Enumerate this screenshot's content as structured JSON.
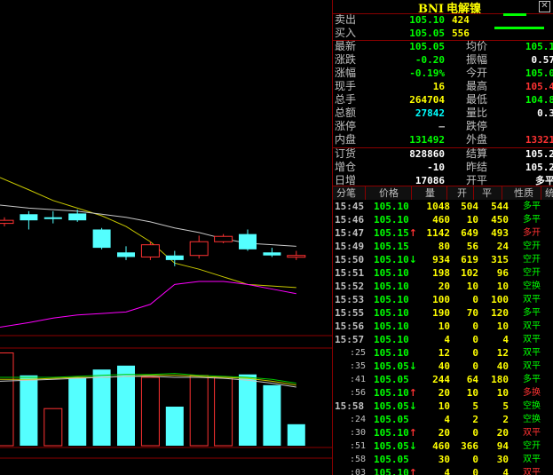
{
  "colors": {
    "up": "#ff3232",
    "down": "#00ff00",
    "volume": "#ffff00",
    "label": "#c0c0c0",
    "grid": "#8b0000",
    "ma_yellow": "#c8c800",
    "ma_white": "#c8c8c8",
    "ma_magenta": "#ff00ff",
    "candle_down": "#54ffff",
    "candle_up": "#ff3232"
  },
  "title": {
    "code": "BNI",
    "name": "电解镍"
  },
  "orderbook": {
    "sell": {
      "label": "卖出",
      "price": "105.10",
      "vol": "424",
      "bar_fraction": 0.43
    },
    "buy": {
      "label": "买入",
      "price": "105.05",
      "vol": "556",
      "bar_fraction": 0.56
    }
  },
  "stats": [
    {
      "l1": "最新",
      "v1": "105.05",
      "c1": "green",
      "l2": "均价",
      "v2": "105.1",
      "c2": "green"
    },
    {
      "l1": "涨跌",
      "v1": "-0.20",
      "c1": "green",
      "l2": "振幅",
      "v2": "0.57",
      "c2": "white"
    },
    {
      "l1": "涨幅",
      "v1": "-0.19%",
      "c1": "green",
      "l2": "今开",
      "v2": "105.0",
      "c2": "green"
    },
    {
      "l1": "现手",
      "v1": "16",
      "c1": "yellow",
      "l2": "最高",
      "v2": "105.4",
      "c2": "red"
    },
    {
      "l1": "总手",
      "v1": "264704",
      "c1": "yellow",
      "l2": "最低",
      "v2": "104.8",
      "c2": "green"
    },
    {
      "l1": "总额",
      "v1": "27842",
      "c1": "cyan",
      "l2": "量比",
      "v2": "0.3",
      "c2": "white"
    },
    {
      "l1": "涨停",
      "v1": "–",
      "c1": "label",
      "l2": "跌停",
      "v2": "",
      "c2": "label"
    },
    {
      "l1": "内盘",
      "v1": "131492",
      "c1": "green",
      "l2": "外盘",
      "v2": "13321",
      "c2": "red"
    }
  ],
  "stats2": [
    {
      "l1": "订货",
      "v1": "828860",
      "c1": "white",
      "l2": "结算",
      "v2": "105.2",
      "c2": "white"
    },
    {
      "l1": "增仓",
      "v1": "-10",
      "c1": "white",
      "l2": "昨结",
      "v2": "105.2",
      "c2": "white"
    },
    {
      "l1": "日增",
      "v1": "17086",
      "c1": "white",
      "l2": "开平",
      "v2": "多平",
      "c2": "white"
    }
  ],
  "ticks_header": {
    "time": "分笔",
    "price": "价格",
    "vol": "量",
    "open": "开",
    "close": "平",
    "nature": "性质",
    "extra": "统"
  },
  "ticks": [
    {
      "time": "15:45",
      "sub": false,
      "price": "105.10",
      "pc": "green",
      "arrow": "",
      "vol": "1048",
      "open": "504",
      "close": "544",
      "nature": "多平",
      "nc": "green"
    },
    {
      "time": "15:46",
      "sub": false,
      "price": "105.10",
      "pc": "green",
      "arrow": "",
      "vol": "460",
      "open": "10",
      "close": "450",
      "nature": "多平",
      "nc": "green"
    },
    {
      "time": "15:47",
      "sub": false,
      "price": "105.15",
      "pc": "green",
      "arrow": "↑",
      "ac": "red",
      "vol": "1142",
      "open": "649",
      "close": "493",
      "nature": "多开",
      "nc": "red"
    },
    {
      "time": "15:49",
      "sub": false,
      "price": "105.15",
      "pc": "green",
      "arrow": "",
      "vol": "80",
      "open": "56",
      "close": "24",
      "nature": "空开",
      "nc": "green"
    },
    {
      "time": "15:50",
      "sub": false,
      "price": "105.10",
      "pc": "green",
      "arrow": "↓",
      "ac": "green",
      "vol": "934",
      "open": "619",
      "close": "315",
      "nature": "空开",
      "nc": "green"
    },
    {
      "time": "15:51",
      "sub": false,
      "price": "105.10",
      "pc": "green",
      "arrow": "",
      "vol": "198",
      "open": "102",
      "close": "96",
      "nature": "空开",
      "nc": "green"
    },
    {
      "time": "15:52",
      "sub": false,
      "price": "105.10",
      "pc": "green",
      "arrow": "",
      "vol": "20",
      "open": "10",
      "close": "10",
      "nature": "空换",
      "nc": "green"
    },
    {
      "time": "15:53",
      "sub": false,
      "price": "105.10",
      "pc": "green",
      "arrow": "",
      "vol": "100",
      "open": "0",
      "close": "100",
      "nature": "双平",
      "nc": "green"
    },
    {
      "time": "15:55",
      "sub": false,
      "price": "105.10",
      "pc": "green",
      "arrow": "",
      "vol": "190",
      "open": "70",
      "close": "120",
      "nature": "多平",
      "nc": "green"
    },
    {
      "time": "15:56",
      "sub": false,
      "price": "105.10",
      "pc": "green",
      "arrow": "",
      "vol": "10",
      "open": "0",
      "close": "10",
      "nature": "双平",
      "nc": "green"
    },
    {
      "time": "15:57",
      "sub": false,
      "price": "105.10",
      "pc": "green",
      "arrow": "",
      "vol": "4",
      "open": "0",
      "close": "4",
      "nature": "双平",
      "nc": "green"
    },
    {
      "time": ":25",
      "sub": true,
      "price": "105.10",
      "pc": "green",
      "arrow": "",
      "vol": "12",
      "open": "0",
      "close": "12",
      "nature": "双平",
      "nc": "green"
    },
    {
      "time": ":35",
      "sub": true,
      "price": "105.05",
      "pc": "green",
      "arrow": "↓",
      "ac": "green",
      "vol": "40",
      "open": "0",
      "close": "40",
      "nature": "双平",
      "nc": "green"
    },
    {
      "time": ":41",
      "sub": true,
      "price": "105.05",
      "pc": "green",
      "arrow": "",
      "vol": "244",
      "open": "64",
      "close": "180",
      "nature": "多平",
      "nc": "green"
    },
    {
      "time": ":56",
      "sub": true,
      "price": "105.10",
      "pc": "green",
      "arrow": "↑",
      "ac": "red",
      "vol": "20",
      "open": "10",
      "close": "10",
      "nature": "多换",
      "nc": "red"
    },
    {
      "time": "15:58",
      "sub": false,
      "price": "105.05",
      "pc": "green",
      "arrow": "↓",
      "ac": "green",
      "vol": "10",
      "open": "5",
      "close": "5",
      "nature": "空换",
      "nc": "green"
    },
    {
      "time": ":24",
      "sub": true,
      "price": "105.05",
      "pc": "green",
      "arrow": "",
      "vol": "4",
      "open": "2",
      "close": "2",
      "nature": "空换",
      "nc": "green"
    },
    {
      "time": ":30",
      "sub": true,
      "price": "105.10",
      "pc": "green",
      "arrow": "↑",
      "ac": "red",
      "vol": "20",
      "open": "0",
      "close": "20",
      "nature": "双平",
      "nc": "red"
    },
    {
      "time": ":51",
      "sub": true,
      "price": "105.05",
      "pc": "green",
      "arrow": "↓",
      "ac": "green",
      "vol": "460",
      "open": "366",
      "close": "94",
      "nature": "空开",
      "nc": "green"
    },
    {
      "time": ":58",
      "sub": true,
      "price": "105.05",
      "pc": "green",
      "arrow": "",
      "vol": "30",
      "open": "0",
      "close": "30",
      "nature": "双平",
      "nc": "green"
    },
    {
      "time": ":03",
      "sub": true,
      "price": "105.10",
      "pc": "green",
      "arrow": "↑",
      "ac": "red",
      "vol": "4",
      "open": "0",
      "close": "4",
      "nature": "双平",
      "nc": "red"
    }
  ],
  "chart_data": {
    "type": "candlestick",
    "candles": [
      {
        "open": 0.7,
        "close": 0.72,
        "high": 0.74,
        "low": 0.68,
        "dir": "up"
      },
      {
        "open": 0.76,
        "close": 0.72,
        "high": 0.78,
        "low": 0.66,
        "dir": "down"
      },
      {
        "open": 0.74,
        "close": 0.735,
        "high": 0.78,
        "low": 0.7,
        "dir": "down"
      },
      {
        "open": 0.765,
        "close": 0.72,
        "high": 0.79,
        "low": 0.71,
        "dir": "down"
      },
      {
        "open": 0.66,
        "close": 0.54,
        "high": 0.67,
        "low": 0.53,
        "dir": "down"
      },
      {
        "open": 0.51,
        "close": 0.48,
        "high": 0.55,
        "low": 0.46,
        "dir": "down"
      },
      {
        "open": 0.48,
        "close": 0.56,
        "high": 0.58,
        "low": 0.46,
        "dir": "up"
      },
      {
        "open": 0.49,
        "close": 0.46,
        "high": 0.52,
        "low": 0.42,
        "dir": "down"
      },
      {
        "open": 0.49,
        "close": 0.58,
        "high": 0.62,
        "low": 0.47,
        "dir": "up"
      },
      {
        "open": 0.58,
        "close": 0.615,
        "high": 0.63,
        "low": 0.57,
        "dir": "up"
      },
      {
        "open": 0.63,
        "close": 0.53,
        "high": 0.66,
        "low": 0.52,
        "dir": "down"
      },
      {
        "open": 0.51,
        "close": 0.49,
        "high": 0.54,
        "low": 0.48,
        "dir": "down"
      },
      {
        "open": 0.485,
        "close": 0.49,
        "high": 0.52,
        "low": 0.46,
        "dir": "up"
      }
    ],
    "ma_yellow": [
      1.0,
      0.92,
      0.85,
      0.8,
      0.75,
      0.68,
      0.58,
      0.44,
      0.4,
      0.35,
      0.3,
      0.29,
      0.28
    ],
    "ma_white": [
      0.82,
      0.8,
      0.79,
      0.78,
      0.76,
      0.74,
      0.71,
      0.67,
      0.64,
      0.6,
      0.57,
      0.56,
      0.55
    ],
    "ma_magenta": [
      0.02,
      0.05,
      0.08,
      0.1,
      0.11,
      0.12,
      0.17,
      0.3,
      0.32,
      0.32,
      0.3,
      0.27,
      0.24
    ],
    "volumes": [
      {
        "v": 0.95,
        "dir": "up"
      },
      {
        "v": 0.72,
        "dir": "down"
      },
      {
        "v": 0.38,
        "dir": "up"
      },
      {
        "v": 0.7,
        "dir": "down"
      },
      {
        "v": 0.78,
        "dir": "down"
      },
      {
        "v": 0.82,
        "dir": "down"
      },
      {
        "v": 0.7,
        "dir": "up"
      },
      {
        "v": 0.4,
        "dir": "down"
      },
      {
        "v": 0.72,
        "dir": "up"
      },
      {
        "v": 0.7,
        "dir": "up"
      },
      {
        "v": 0.73,
        "dir": "down"
      },
      {
        "v": 0.62,
        "dir": "down"
      },
      {
        "v": 0.22,
        "dir": "down"
      }
    ],
    "vol_ma_green": [
      0.7,
      0.7,
      0.7,
      0.71,
      0.72,
      0.73,
      0.73,
      0.74,
      0.72,
      0.71,
      0.7,
      0.68,
      0.64
    ],
    "vol_ma_yellow": [
      0.68,
      0.68,
      0.69,
      0.7,
      0.7,
      0.71,
      0.72,
      0.72,
      0.71,
      0.7,
      0.69,
      0.66,
      0.62
    ],
    "vol_ma_white": [
      0.66,
      0.67,
      0.68,
      0.69,
      0.7,
      0.71,
      0.71,
      0.7,
      0.7,
      0.69,
      0.67,
      0.64,
      0.6
    ]
  }
}
